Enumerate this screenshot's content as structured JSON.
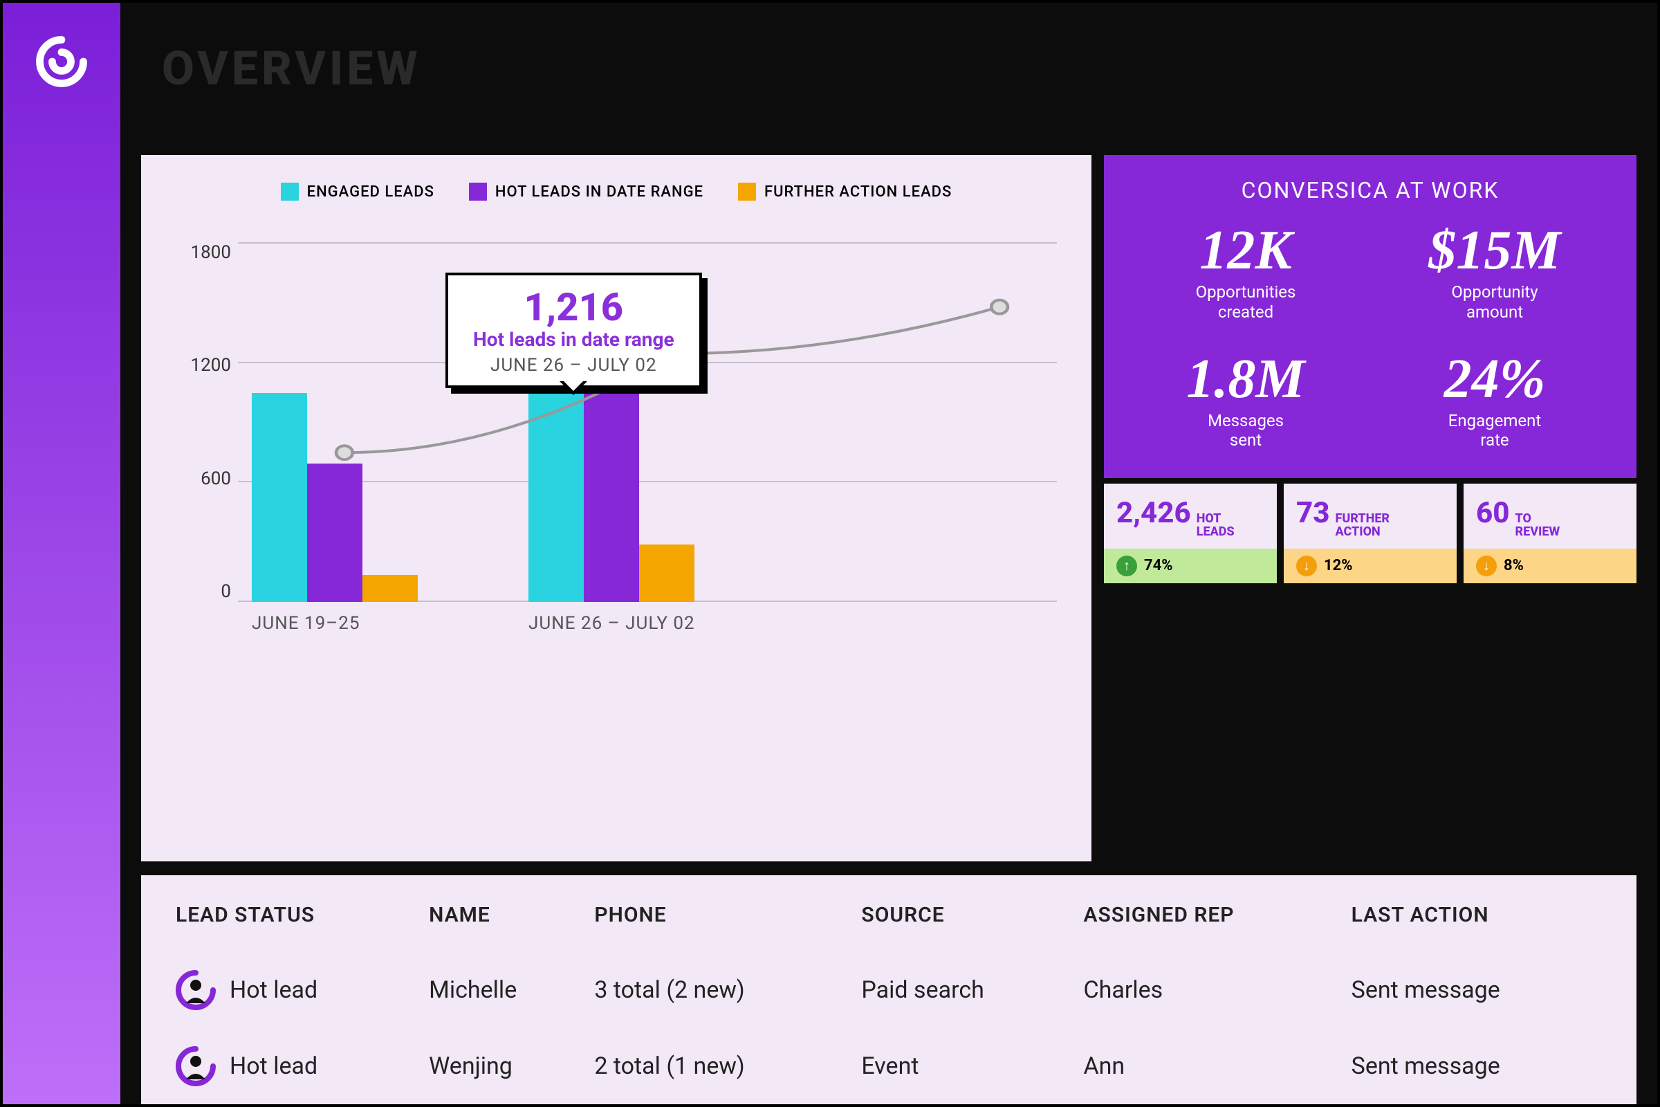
{
  "page_title": "OVERVIEW",
  "colors": {
    "engaged": "#29d3e0",
    "hot": "#8627d8",
    "further": "#f5a500",
    "card_bg": "#f2e8f6",
    "stat_bg": "#8627d8"
  },
  "legend": {
    "engaged": "ENGAGED LEADS",
    "hot": "HOT LEADS IN DATE RANGE",
    "further": "FURTHER ACTION LEADS"
  },
  "tooltip": {
    "value": "1,216",
    "label": "Hot leads in date range",
    "range": "JUNE 26 – JULY 02"
  },
  "stats_card": {
    "title": "CONVERSICA AT WORK",
    "items": [
      {
        "value": "12K",
        "label": "Opportunities\ncreated"
      },
      {
        "value": "$15M",
        "label": "Opportunity\namount"
      },
      {
        "value": "1.8M",
        "label": "Messages\nsent"
      },
      {
        "value": "24%",
        "label": "Engagement\nrate"
      }
    ]
  },
  "mini_cards": [
    {
      "num": "2,426",
      "label": "HOT\nLEADS",
      "delta": "74%",
      "direction": "up"
    },
    {
      "num": "73",
      "label": "FURTHER\nACTION",
      "delta": "12%",
      "direction": "down"
    },
    {
      "num": "60",
      "label": "TO\nREVIEW",
      "delta": "8%",
      "direction": "down"
    }
  ],
  "table": {
    "headers": {
      "lead_status": "LEAD STATUS",
      "name": "NAME",
      "phone": "PHONE",
      "source": "SOURCE",
      "assigned_rep": "ASSIGNED REP",
      "last_action": "LAST ACTION"
    },
    "rows": [
      {
        "status": "Hot lead",
        "name": "Michelle",
        "phone": "3 total (2 new)",
        "source": "Paid search",
        "rep": "Charles",
        "action": "Sent message"
      },
      {
        "status": "Hot lead",
        "name": "Wenjing",
        "phone": "2 total (1 new)",
        "source": "Event",
        "rep": "Ann",
        "action": "Sent message"
      }
    ]
  },
  "chart_data": {
    "type": "bar",
    "ylim": [
      0,
      2000
    ],
    "yticks": [
      1800,
      1200,
      600,
      0
    ],
    "categories": [
      "JUNE 19–25",
      "JUNE 26 – JULY 02"
    ],
    "series": [
      {
        "name": "ENGAGED LEADS",
        "values": [
          1160,
          1580
        ],
        "color": "#29d3e0"
      },
      {
        "name": "HOT LEADS IN DATE RANGE",
        "values": [
          770,
          1216
        ],
        "color": "#8627d8"
      },
      {
        "name": "FURTHER ACTION LEADS",
        "values": [
          150,
          320
        ],
        "color": "#f5a500"
      }
    ],
    "trend": [
      830,
      1380,
      1640
    ]
  }
}
